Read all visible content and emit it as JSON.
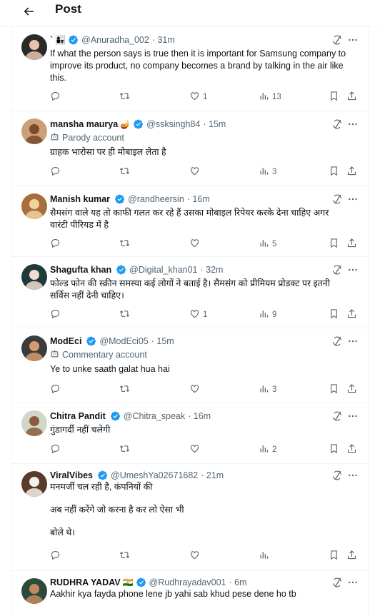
{
  "header": {
    "title": "Post"
  },
  "colors": {
    "verified": "#1d9bf0",
    "muted": "#536471",
    "divider": "#eff3f4"
  },
  "icons": {
    "back": "arrow-left-icon",
    "verified": "verified-badge-icon",
    "grok": "grok-icon",
    "more": "more-icon",
    "reply": "reply-icon",
    "retweet": "retweet-icon",
    "like": "heart-icon",
    "views": "views-icon",
    "bookmark": "bookmark-icon",
    "share": "share-icon",
    "label": "robot-label-icon"
  },
  "tweets": [
    {
      "name": "`",
      "name_extra": "👩‍👧",
      "handle": "@Anuradha_002",
      "time": "· 31m",
      "label": "",
      "text": [
        "If what the person says is true then it is important for Samsung company to",
        "improve its product, no company becomes a brand by talking in the air like",
        "this."
      ],
      "replies": "",
      "retweets": "",
      "likes": "1",
      "views": "13"
    },
    {
      "name": "mansha maurya",
      "name_extra": "🪔",
      "handle": "@ssksingh84",
      "time": "· 15m",
      "label": "Parody account",
      "text": [
        "ग्राहक भारोसा पर ही मोबाइल लेता है"
      ],
      "replies": "",
      "retweets": "",
      "likes": "",
      "views": "3"
    },
    {
      "name": "Manish kumar",
      "name_extra": "",
      "handle": "@randheersin",
      "time": "· 16m",
      "label": "",
      "text": [
        "सैमसंग वाले यह तो काफी गलत कर रहे हैं उसका मोबाइल रिपेयर करके देना चाहिए अगर",
        "वारंटी पीरियड में है"
      ],
      "replies": "",
      "retweets": "",
      "likes": "",
      "views": "5"
    },
    {
      "name": "Shagufta khan",
      "name_extra": "",
      "handle": "@Digital_khan01",
      "time": "· 32m",
      "label": "",
      "text": [
        "फोल्ड फोन की स्क्रीन समस्या कई लोगों ने बताई है। सैमसंग को प्रीमियम प्रोडक्ट पर इतनी",
        "सर्विस नहीं देनी चाहिए।"
      ],
      "replies": "",
      "retweets": "",
      "likes": "1",
      "views": "9"
    },
    {
      "name": "ModEci",
      "name_extra": "",
      "handle": "@ModEci05",
      "time": "· 15m",
      "label": "Commentary account",
      "text": [
        "Ye to unke saath galat hua hai"
      ],
      "replies": "",
      "retweets": "",
      "likes": "",
      "views": "3"
    },
    {
      "name": "Chitra Pandit",
      "name_extra": "",
      "handle": "@Chitra_speak",
      "time": "· 16m",
      "label": "",
      "text": [
        "गुंडागर्दी नहीं चलेगी"
      ],
      "replies": "",
      "retweets": "",
      "likes": "",
      "views": "2"
    },
    {
      "name": "ViralVibes",
      "name_extra": "",
      "handle": "@UmeshYa02671682",
      "time": "· 21m",
      "label": "",
      "text": [
        "मनमर्जी चल रही है, कंपनियों की",
        "",
        "अब नहीं करेंगे जो करना है कर लो ऐसा भी",
        "",
        "बोले थे।"
      ],
      "replies": "",
      "retweets": "",
      "likes": "",
      "views": ""
    },
    {
      "name": "RUDHRA YADAV",
      "name_extra": "🇮🇳",
      "handle": "@Rudhrayadav001",
      "time": "· 6m",
      "label": "",
      "text": [
        "Aakhir kya fayda phone lene jb yahi sab khud pese dene ho tb"
      ],
      "replies": "",
      "retweets": "",
      "likes": "",
      "views": ""
    }
  ]
}
